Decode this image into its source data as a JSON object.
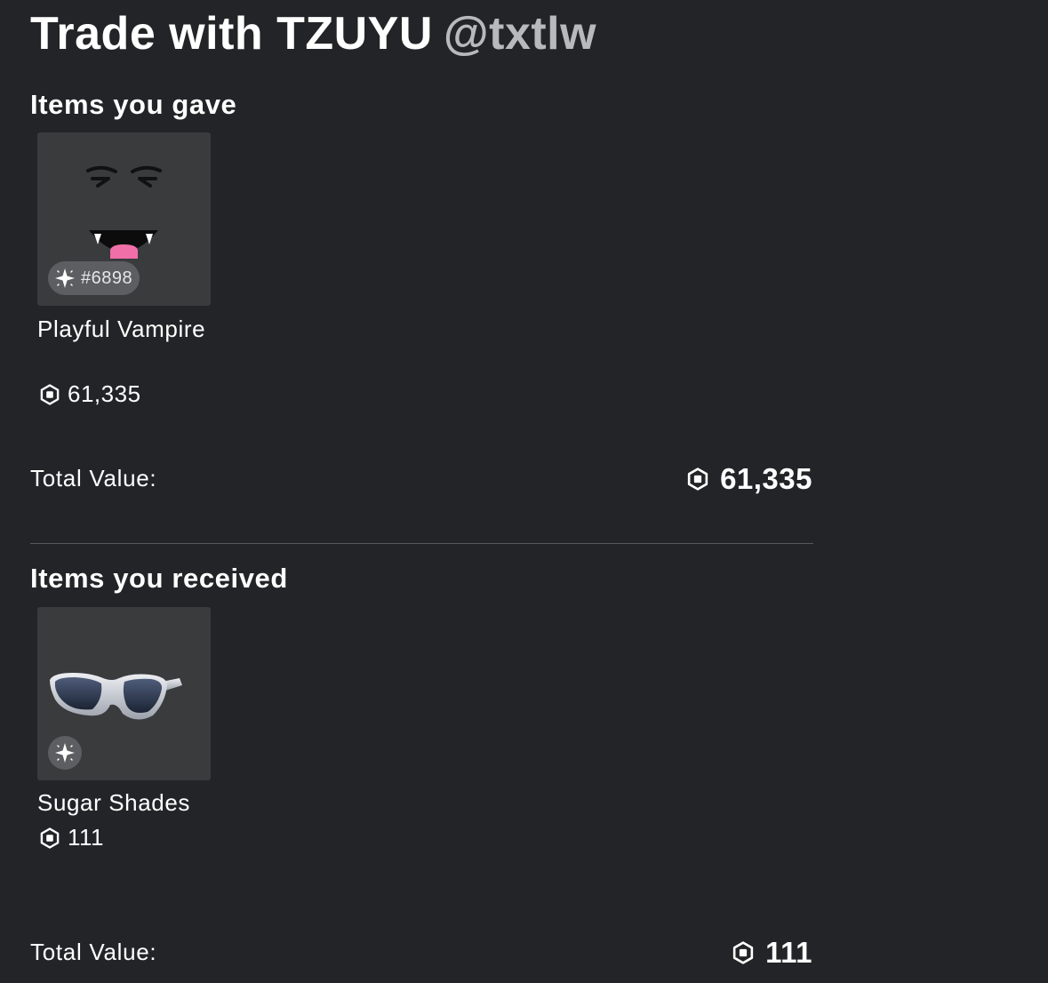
{
  "header": {
    "title": "Trade with TZUYU",
    "handle": "@txtlw"
  },
  "gave": {
    "heading": "Items you gave",
    "items": [
      {
        "name": "Playful Vampire",
        "value": "61,335",
        "serial": "#6898",
        "icon": "playful-vampire-face"
      }
    ],
    "total_label": "Total Value:",
    "total_value": "61,335"
  },
  "received": {
    "heading": "Items you received",
    "items": [
      {
        "name": "Sugar Shades",
        "value": "111",
        "serial": "",
        "icon": "sugar-shades-glasses"
      }
    ],
    "total_label": "Total Value:",
    "total_value": "111"
  },
  "colors": {
    "background": "#232427",
    "card": "#393b3d",
    "badge": "#5c5e61",
    "handle": "#b8b9bb"
  }
}
